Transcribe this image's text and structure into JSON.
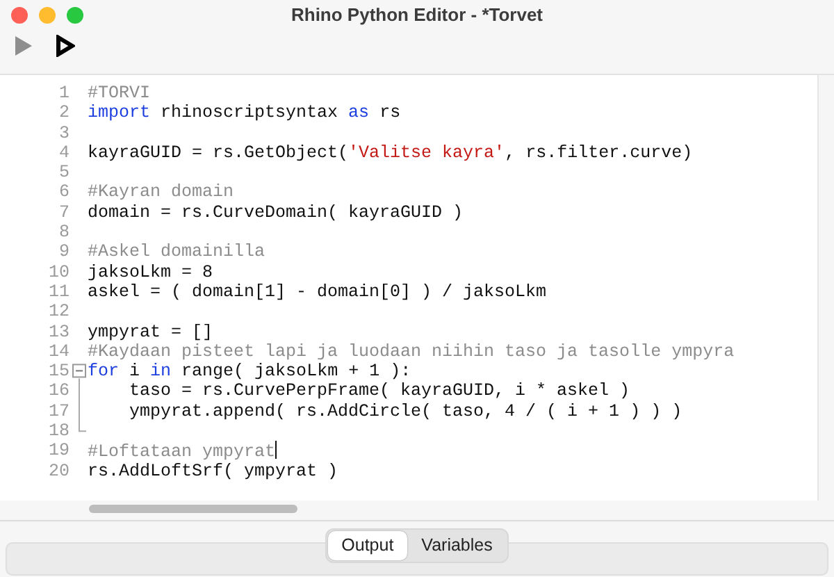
{
  "window": {
    "title": "Rhino Python Editor - *Torvet"
  },
  "toolbar": [
    {
      "kind": "run",
      "disabled": true
    },
    {
      "kind": "debug",
      "disabled": false
    }
  ],
  "editor": {
    "lines": [
      {
        "number": "1",
        "cursor": false,
        "tokens": [
          {
            "kind": "comment",
            "text": "#TORVI"
          }
        ]
      },
      {
        "number": "2",
        "cursor": false,
        "tokens": [
          {
            "kind": "keyword",
            "text": "import"
          },
          {
            "kind": "plain",
            "text": " rhinoscriptsyntax "
          },
          {
            "kind": "keyword",
            "text": "as"
          },
          {
            "kind": "plain",
            "text": " rs"
          }
        ]
      },
      {
        "number": "3",
        "cursor": false
      },
      {
        "number": "4",
        "cursor": false,
        "tokens": [
          {
            "kind": "plain",
            "text": "kayraGUID = rs.GetObject("
          },
          {
            "kind": "string",
            "text": "'Valitse kayra'"
          },
          {
            "kind": "plain",
            "text": ", rs.filter.curve)"
          }
        ]
      },
      {
        "number": "5",
        "cursor": false
      },
      {
        "number": "6",
        "cursor": false,
        "tokens": [
          {
            "kind": "comment",
            "text": "#Kayran domain"
          }
        ]
      },
      {
        "number": "7",
        "cursor": false,
        "tokens": [
          {
            "kind": "plain",
            "text": "domain = rs.CurveDomain( kayraGUID )"
          }
        ]
      },
      {
        "number": "8",
        "cursor": false
      },
      {
        "number": "9",
        "cursor": false,
        "tokens": [
          {
            "kind": "comment",
            "text": "#Askel domainilla"
          }
        ]
      },
      {
        "number": "10",
        "cursor": false,
        "tokens": [
          {
            "kind": "plain",
            "text": "jaksoLkm = 8"
          }
        ]
      },
      {
        "number": "11",
        "cursor": false,
        "tokens": [
          {
            "kind": "plain",
            "text": "askel = ( domain[1] - domain[0] ) / jaksoLkm"
          }
        ]
      },
      {
        "number": "12",
        "cursor": false
      },
      {
        "number": "13",
        "cursor": false,
        "tokens": [
          {
            "kind": "plain",
            "text": "ympyrat = []"
          }
        ]
      },
      {
        "number": "14",
        "cursor": false,
        "tokens": [
          {
            "kind": "comment",
            "text": "#Kaydaan pisteet lapi ja luodaan niihin taso ja tasolle ympyra"
          }
        ]
      },
      {
        "number": "15",
        "cursor": false,
        "expanded": true,
        "tokens": [
          {
            "kind": "keyword",
            "text": "for"
          },
          {
            "kind": "plain",
            "text": " i "
          },
          {
            "kind": "keyword",
            "text": "in"
          },
          {
            "kind": "plain",
            "text": " range( jaksoLkm + 1 ):"
          }
        ],
        "children": [
          {
            "number": "16",
            "cursor": false,
            "tokens": [
              {
                "kind": "plain",
                "text": "    taso = rs.CurvePerpFrame( kayraGUID, i * askel )"
              }
            ]
          },
          {
            "number": "17",
            "cursor": false,
            "tokens": [
              {
                "kind": "plain",
                "text": "    ympyrat.append( rs.AddCircle( taso, 4 / ( i + 1 ) ) )"
              }
            ]
          },
          {
            "number": "18",
            "cursor": false
          }
        ]
      },
      {
        "number": "19",
        "cursor": true,
        "tokens": [
          {
            "kind": "comment",
            "text": "#Loftataan ympyrat"
          }
        ]
      },
      {
        "number": "20",
        "cursor": false,
        "tokens": [
          {
            "kind": "plain",
            "text": "rs.AddLoftSrf( ympyrat )"
          }
        ]
      }
    ]
  },
  "bottom_tabs": [
    {
      "label": "Output",
      "selected": true
    },
    {
      "label": "Variables",
      "selected": false
    }
  ]
}
